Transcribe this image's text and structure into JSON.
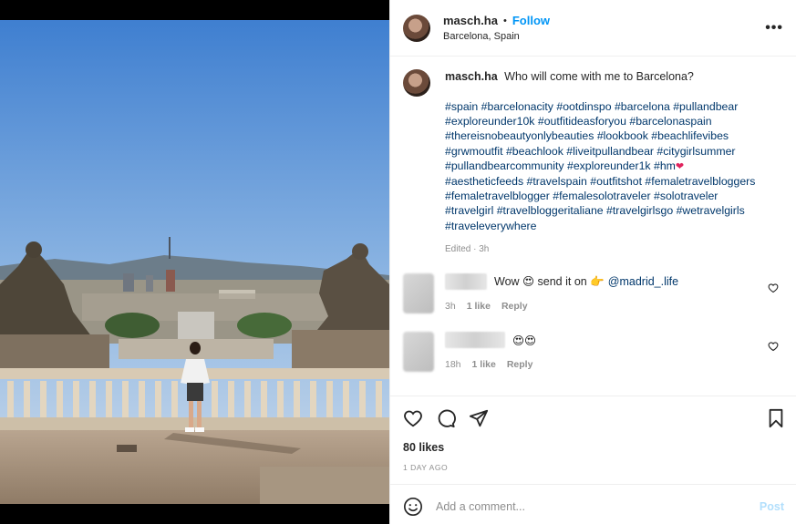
{
  "post": {
    "username": "masch.ha",
    "follow_label": "Follow",
    "separator": "•",
    "location": "Barcelona, Spain",
    "more_label": "•••"
  },
  "caption": {
    "username": "masch.ha",
    "text": "Who will come with me to Barcelona?",
    "hashtag_lines": [
      "#spain #barcelonacity #ootdinspo #barcelona #pullandbear",
      "#exploreunder10k #outfitideasforyou #barcelonaspain",
      "#thereisnobeautyonlybeauties #lookbook #beachlifevibes",
      "#grwmoutfit #beachlook #liveitpullandbear #citygirlsummer",
      "#pullandbearcommunity #exploreunder1k #hm",
      "#aestheticfeeds #travelspain #outfitshot #femaletravelbloggers",
      "#femaletravelblogger #femalesolotraveler #solotraveler",
      "#travelgirl #travelbloggeritaliane #travelgirlsgo #wetravelgirls",
      "#traveleverywhere"
    ],
    "heart_emoji": "❤",
    "edited": "Edited · 3h"
  },
  "comments": [
    {
      "text": "Wow 😍 send it on 👉",
      "mention": "@madrid_.life",
      "time": "3h",
      "likes": "1 like",
      "reply": "Reply"
    },
    {
      "text": "😍😍",
      "mention": "",
      "time": "18h",
      "likes": "1 like",
      "reply": "Reply"
    }
  ],
  "stats": {
    "likes": "80 likes",
    "date": "1 DAY AGO"
  },
  "add_comment": {
    "placeholder": "Add a comment...",
    "post_label": "Post"
  },
  "colors": {
    "accent": "#0095f6",
    "link": "#00376b",
    "muted": "#8e8e8e",
    "post_disabled": "#b2dffc"
  },
  "icons": {
    "like": "heart-outline-icon",
    "comment": "speech-bubble-icon",
    "share": "paper-plane-icon",
    "save": "bookmark-icon",
    "emoji": "smiley-icon",
    "more": "ellipsis-icon"
  }
}
